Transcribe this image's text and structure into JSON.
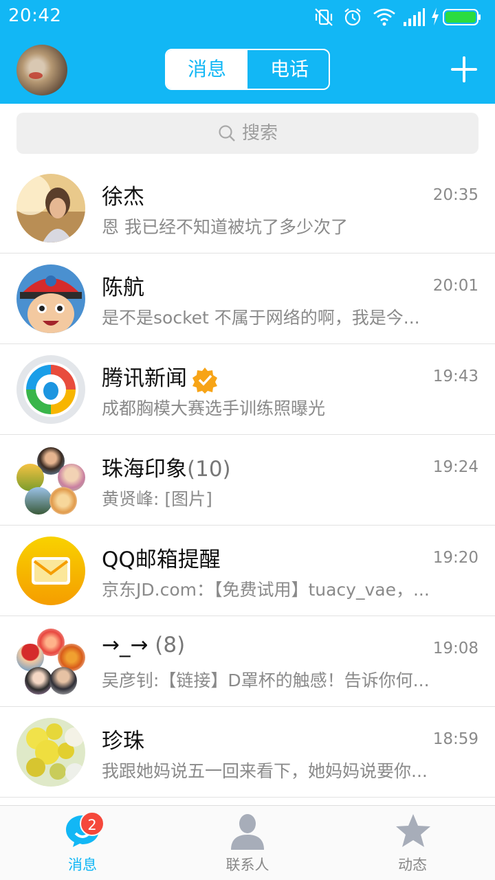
{
  "status_bar": {
    "time": "20:42",
    "icons": [
      "vibrate-off-icon",
      "alarm-icon",
      "wifi-icon",
      "signal-icon",
      "charging-icon",
      "battery-icon"
    ]
  },
  "header": {
    "tabs": [
      {
        "label": "消息",
        "active": true
      },
      {
        "label": "电话",
        "active": false
      }
    ],
    "add_icon": "plus-icon"
  },
  "search": {
    "placeholder": "搜索"
  },
  "conversations": [
    {
      "name": "徐杰",
      "time": "20:35",
      "preview": "恩 我已经不知道被坑了多少次了"
    },
    {
      "name": "陈航",
      "time": "20:01",
      "preview": "是不是socket 不属于网络的啊，我是今..."
    },
    {
      "name": "腾讯新闻",
      "verified": true,
      "time": "19:43",
      "preview": "成都胸模大赛选手训练照曝光"
    },
    {
      "name": "珠海印象",
      "count": "(10)",
      "time": "19:24",
      "preview": "黄贤峰: [图片]"
    },
    {
      "name": "QQ邮箱提醒",
      "time": "19:20",
      "preview": "京东JD.com：【免费试用】tuacy_vae，..."
    },
    {
      "name": "→_→",
      "count": " (8)",
      "time": "19:08",
      "preview": "吴彦钊:【链接】D罩杯的触感！告诉你何..."
    },
    {
      "name": "珍珠",
      "time": "18:59",
      "preview": "我跟她妈说五一回来看下，她妈妈说要你..."
    }
  ],
  "tabbar": {
    "items": [
      {
        "label": "消息",
        "active": true,
        "badge": "2"
      },
      {
        "label": "联系人",
        "active": false
      },
      {
        "label": "动态",
        "active": false
      }
    ]
  },
  "colors": {
    "brand": "#12b7f5",
    "badge": "#f5483b",
    "inactive_icon": "#a7adb9"
  }
}
